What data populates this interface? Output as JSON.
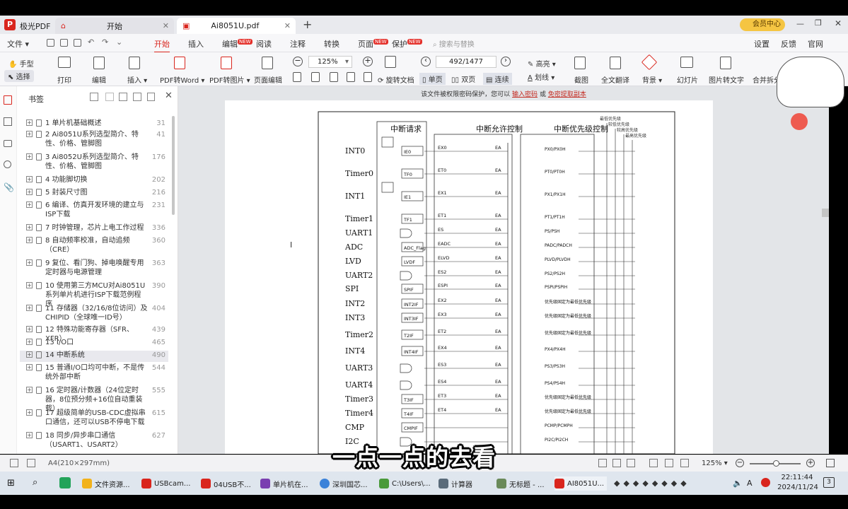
{
  "titlebar": {
    "app_name": "极光PDF",
    "tabs": [
      {
        "label": "开始"
      },
      {
        "label": "Ai8051U.pdf"
      }
    ],
    "member_label": "会员中心"
  },
  "menubar": {
    "items": [
      "文件",
      "开始",
      "插入",
      "编辑",
      "阅读",
      "注释",
      "转换",
      "页面",
      "保护"
    ],
    "new_badge": "NEW",
    "search_placeholder": "搜索与替换",
    "right_items": [
      "设置",
      "反馈",
      "官网"
    ]
  },
  "toolbar": {
    "hand": "手型",
    "select": "选择",
    "print": "打印",
    "edit": "编辑",
    "insert": "插入",
    "pdf_word": "PDF转Word",
    "pdf_image": "PDF转图片",
    "page_edit": "页面编辑",
    "zoom": "125%",
    "page": "492/1477",
    "rotate": "旋转文档",
    "single": "单页",
    "double": "双页",
    "continuous": "连续",
    "highlight": "高亮",
    "underline": "划线",
    "screenshot": "截图",
    "translate": "全文翻译",
    "background": "背景",
    "slides": "幻灯片",
    "img_text": "图片转文字",
    "split": "合并拆分"
  },
  "sidebar": {
    "title": "书签",
    "items": [
      {
        "label": "1 单片机基础概述",
        "page": "31"
      },
      {
        "label": "2 Ai8051U系列选型简介、特性、价格、管脚图",
        "page": "41"
      },
      {
        "label": "3 Ai8052U系列选型简介、特性、价格、管脚图",
        "page": "176"
      },
      {
        "label": "4 功能脚切换",
        "page": "202"
      },
      {
        "label": "5 封装尺寸图",
        "page": "216"
      },
      {
        "label": "6 编译、仿真开发环境的建立与ISP下载",
        "page": "231"
      },
      {
        "label": "7 时钟管理，芯片上电工作过程",
        "page": "336"
      },
      {
        "label": "8 自动频率校准，自动追频（CRE）",
        "page": "360"
      },
      {
        "label": "9 复位、看门狗、掉电唤醒专用定时器与电源管理",
        "page": "363"
      },
      {
        "label": "10 使用第三方MCU对Ai8051U系列单片机进行ISP下载范例程序",
        "page": "390"
      },
      {
        "label": "11 存储器（32/16/8位访问）及CHIPID（全球唯一ID号）",
        "page": "404"
      },
      {
        "label": "12 特殊功能寄存器（SFR、XFR）",
        "page": "439"
      },
      {
        "label": "13 I/O口",
        "page": "465"
      },
      {
        "label": "14 中断系统",
        "page": "490"
      },
      {
        "label": "15 普通I/O口均可中断，不是传统外部中断",
        "page": "544"
      },
      {
        "label": "16 定时器/计数器（24位定时器，8位预分频+16位自动重装载）",
        "page": "555"
      },
      {
        "label": "17 超级简单的USB-CDC虚拟串口通信，还可以USB不停电下载",
        "page": "615"
      },
      {
        "label": "18 同步/异步串口通信（USART1、USART2）",
        "page": "627"
      }
    ]
  },
  "notice": {
    "text": "该文件被权限密码保护，您可以",
    "link1": "输入密码",
    "or": "或",
    "link2": "免密提取副本"
  },
  "diagram": {
    "headers": [
      "中断请求",
      "中断允许控制",
      "中断优先级控制"
    ],
    "priority_labels": [
      "最低优先级",
      "较低优先级",
      "较高优先级",
      "最高优先级"
    ],
    "sources": [
      "INT0",
      "Timer0",
      "INT1",
      "Timer1",
      "UART1",
      "ADC",
      "LVD",
      "UART2",
      "SPI",
      "INT2",
      "INT3",
      "Timer2",
      "INT4",
      "UART3",
      "UART4",
      "Timer3",
      "Timer4",
      "CMP",
      "I2C"
    ],
    "flags": [
      "IE0",
      "TF0",
      "IE1",
      "TF1",
      "",
      "ADC_Flag",
      "LVDF",
      "",
      "SPIF",
      "INT2IF",
      "INT3IF",
      "T2IF",
      "INT4IF",
      "",
      "",
      "T3IF",
      "T4IF",
      "CMPIF",
      ""
    ],
    "enables": [
      "EX0",
      "ET0",
      "EX1",
      "ET1",
      "ES",
      "EADC",
      "ELVD",
      "ES2",
      "ESPI",
      "EX2",
      "EX3",
      "ET2",
      "EX4",
      "ES3",
      "ES4",
      "ET3",
      "ET4",
      "",
      ""
    ],
    "priorities": [
      "PX0/PX0H",
      "PT0/PT0H",
      "PX1/PX1H",
      "PT1/PT1H",
      "PS/PSH",
      "PADC/PADCH",
      "PLVD/PLVDH",
      "PS2/PS2H",
      "PSPI/PSPIH",
      "优先级固定为最低优先级",
      "优先级固定为最低优先级",
      "优先级固定为最低优先级",
      "PX4/PX4H",
      "PS3/PS3H",
      "PS4/PS4H",
      "优先级固定为最低优先级",
      "优先级固定为最低优先级",
      "PCMP/PCMPH",
      "PI2C/PI2CH"
    ],
    "ea": "EA"
  },
  "statusbar": {
    "page_size": "A4(210×297mm)",
    "zoom": "125%"
  },
  "taskbar": {
    "apps": [
      "文件资源...",
      "USBcam...",
      "04USB不...",
      "单片机在...",
      "深圳国芯...",
      "C:\\Users\\...",
      "计算器",
      "无标题 - ...",
      "AI8051U..."
    ],
    "time": "22:11:44",
    "date": "2024/11/24",
    "ime": "A",
    "notif": "3"
  },
  "subtitle": "一点一点的去看",
  "colors": {
    "accent": "#d9251d",
    "taskbar": "#dfe6ee"
  }
}
